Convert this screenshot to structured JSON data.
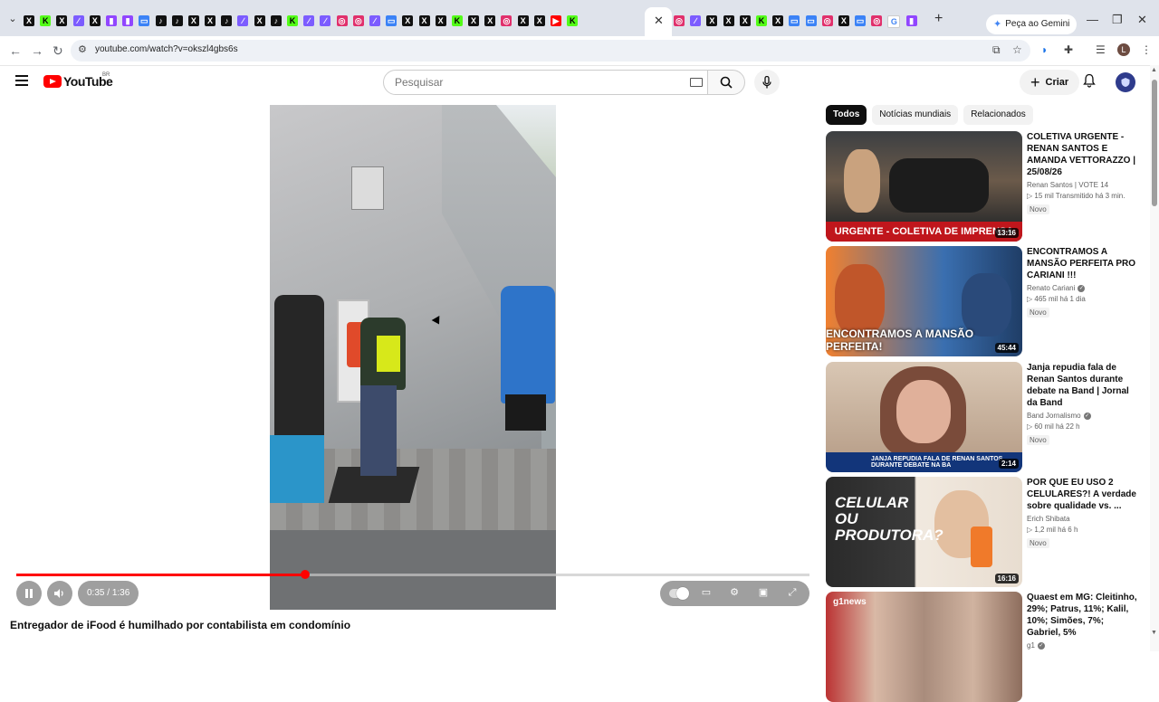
{
  "browser": {
    "url": "youtube.com/watch?v=okszl4gbs6s",
    "gemini_label": "Peça ao Gemini",
    "profile_initial": "L",
    "tab_favicons": [
      "x",
      "k",
      "x",
      "pl",
      "x",
      "tw",
      "tw",
      "bl",
      "tt",
      "tt",
      "x",
      "x",
      "tt",
      "pl",
      "x",
      "tt",
      "k",
      "pl",
      "pl",
      "ig",
      "ig",
      "pl",
      "bl",
      "x",
      "x",
      "x",
      "k",
      "x",
      "x",
      "ig",
      "x",
      "x",
      "yt",
      "k"
    ],
    "tab_favicons_right": [
      "ig",
      "pl",
      "x",
      "x",
      "x",
      "k",
      "x",
      "bl",
      "bl",
      "ig",
      "x",
      "bl",
      "ig",
      "gg",
      "tw"
    ]
  },
  "youtube": {
    "logo_text": "YouTube",
    "country_code": "BR",
    "search_placeholder": "Pesquisar",
    "create_label": "Criar"
  },
  "player": {
    "time_current": "0:35",
    "time_total": "1:36",
    "progress_fraction": 0.3646,
    "title": "Entregador de iFood é humilhado por contabilista em condomínio"
  },
  "sidebar": {
    "chips": [
      {
        "label": "Todos",
        "active": true
      },
      {
        "label": "Notícias mundiais",
        "active": false
      },
      {
        "label": "Relacionados",
        "active": false
      }
    ],
    "recs": [
      {
        "title": "COLETIVA URGENTE - RENAN SANTOS E AMANDA VETTORAZZO | 25/08/26",
        "channel": "Renan Santos | VOTE 14",
        "verified": false,
        "meta": "▷ 15 mil  Transmitido há 3 min.",
        "badge": "Novo",
        "duration": "13:16",
        "caption": "URGENTE - COLETIVA DE IMPRENSA"
      },
      {
        "title": "ENCONTRAMOS A MANSÃO PERFEITA PRO CARIANI !!!",
        "channel": "Renato Cariani",
        "verified": true,
        "meta": "▷ 465 mil  há 1 dia",
        "badge": "Novo",
        "duration": "45:44",
        "caption": "ENCONTRAMOS A MANSÃO PERFEITA!"
      },
      {
        "title": "Janja repudia fala de Renan Santos durante debate na Band | Jornal da Band",
        "channel": "Band Jornalismo",
        "verified": true,
        "meta": "▷ 60 mil  há 22 h",
        "badge": "Novo",
        "duration": "2:14",
        "caption": "JANJA REPUDIA FALA DE RENAN SANTOS DURANTE DEBATE NA BA"
      },
      {
        "title": "POR QUE EU USO 2 CELULARES?! A verdade sobre qualidade vs. ...",
        "channel": "Erich Shibata",
        "verified": false,
        "meta": "▷ 1,2 mil  há 6 h",
        "badge": "Novo",
        "duration": "16:16",
        "caption": "CELULAR OU PRODUTORA?"
      },
      {
        "title": "Quaest em MG: Cleitinho, 29%; Patrus, 11%; Kalil, 10%; Simões, 7%; Gabriel, 5%",
        "channel": "g1",
        "verified": true,
        "meta": "",
        "badge": "",
        "duration": "",
        "caption": "g1news"
      }
    ]
  }
}
